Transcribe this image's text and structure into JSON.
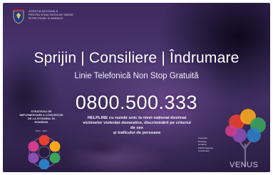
{
  "agency": {
    "lines": [
      "Agenția Națională",
      "pentru Egalitatea de Șanse",
      "între Femei și Bărbați"
    ]
  },
  "headline": "Sprijin | Consiliere | Îndrumare",
  "subline": "Linie Telefonică Non Stop Gratuită",
  "phone": "0800.500.333",
  "helpline": {
    "lines": [
      "HELPLINE cu număr unic la nivel național destinat",
      "victimelor violenței domestice, discriminării pe criteriul de sex",
      "și traficului de persoane"
    ]
  },
  "strategy": {
    "lines": [
      "Strategia de",
      "implementare a Convenției",
      "de la Istanbul în",
      "România"
    ],
    "note": "2022 - 2027"
  },
  "venus": {
    "word": "VENUS",
    "items": [
      "Prevenire",
      "Protecție",
      "Urmărire",
      "Politici integrate",
      "Coordonare"
    ]
  },
  "colors": {
    "background": "#3e2a5e",
    "text": "#ffffff",
    "cycle": [
      "#e8402f",
      "#f6a81c",
      "#3aa35c",
      "#2c7ec2",
      "#8a4fb5",
      "#d23c8c"
    ],
    "tree": [
      "#e8402f",
      "#f6a81c",
      "#3aa35c",
      "#2c7ec2",
      "#8a4fb5",
      "#d23c8c"
    ]
  },
  "icons": {
    "crest": "romanian-coat-of-arms-icon",
    "cycle": "strategy-cycle-icon",
    "tree": "venus-tree-icon"
  }
}
